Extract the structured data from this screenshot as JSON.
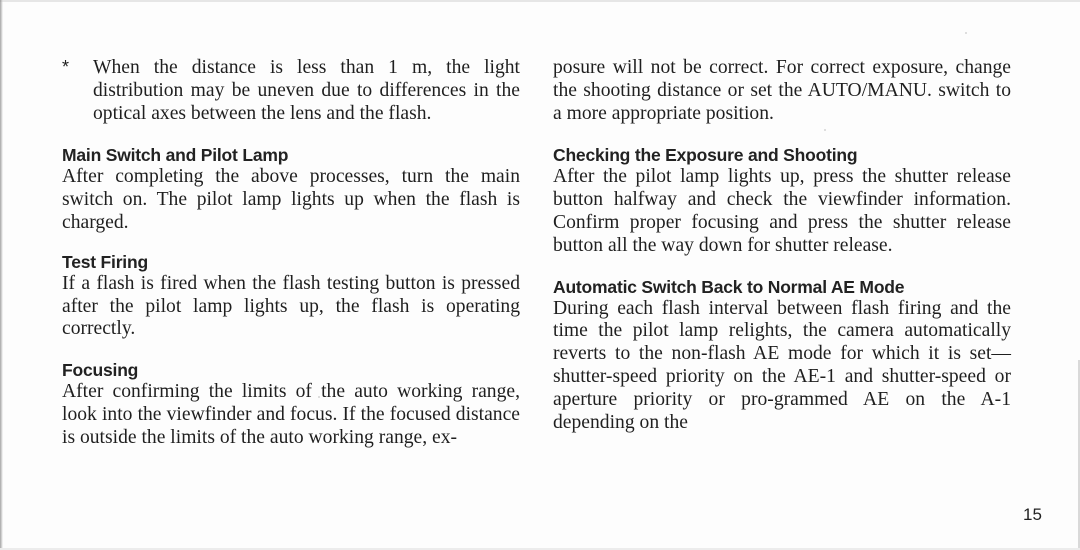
{
  "page": {
    "page_number": "15",
    "left_column": {
      "footnote": {
        "marker": "*",
        "text": "When the distance is less than 1 m, the light distribution may be uneven due to differences in the optical axes between the lens and the flash."
      },
      "sections": [
        {
          "heading": "Main Switch and Pilot Lamp",
          "body": "After completing the above processes, turn the main switch on. The pilot lamp lights up when the flash is charged."
        },
        {
          "heading": "Test Firing",
          "body": "If a flash is fired when the flash testing button is pressed after the pilot lamp lights up, the flash is operating correctly."
        },
        {
          "heading": "Focusing",
          "body": "After confirming the limits of the auto working range, look into the viewfinder and focus. If the focused distance is outside the limits of the auto working range, ex-"
        }
      ]
    },
    "right_column": {
      "continuation": "posure will not be correct. For correct exposure, change the shooting distance or set the AUTO/MANU. switch to a more appropriate position.",
      "sections": [
        {
          "heading": "Checking the Exposure and Shooting",
          "body": "After the pilot lamp lights up, press the shutter release button halfway and check the viewfinder information. Confirm proper focusing and press the shutter release button all the way down for shutter release."
        },
        {
          "heading": "Automatic Switch Back to Normal AE Mode",
          "body": "During each flash interval between flash firing and the time the pilot lamp relights, the camera automatically reverts to the non-flash AE mode for which it is set—shutter-speed priority on the AE-1 and shutter-speed or aperture priority or pro-grammed AE on the A-1 depending on the"
        }
      ]
    }
  }
}
